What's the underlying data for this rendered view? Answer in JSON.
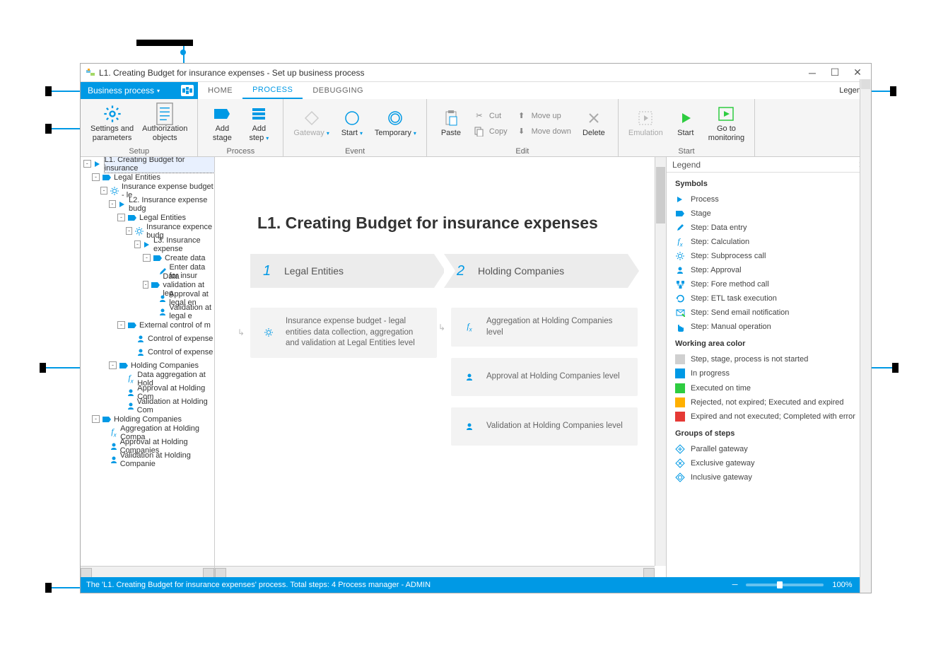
{
  "window": {
    "title": "L1. Creating Budget for insurance expenses - Set up business process"
  },
  "menubar": {
    "file_menu": "Business process",
    "tabs": [
      "HOME",
      "PROCESS",
      "DEBUGGING"
    ],
    "active_tab_index": 1,
    "right": "Legend"
  },
  "ribbon": {
    "groups": [
      {
        "label": "Setup",
        "buttons": [
          {
            "label": "Settings and\nparameters",
            "icon": "gear"
          },
          {
            "label": "Authorization\nobjects",
            "icon": "doc-lines"
          }
        ]
      },
      {
        "label": "Process",
        "buttons": [
          {
            "label": "Add\nstage",
            "icon": "stage-shape"
          },
          {
            "label": "Add\nstep",
            "icon": "bars",
            "dropdown": true
          }
        ]
      },
      {
        "label": "Event",
        "buttons": [
          {
            "label": "Gateway",
            "icon": "diamond",
            "disabled": true,
            "dropdown": true
          },
          {
            "label": "Start",
            "icon": "circle",
            "dropdown": true
          },
          {
            "label": "Temporary",
            "icon": "double-circle",
            "dropdown": true
          }
        ]
      },
      {
        "label": "Edit",
        "buttons_col1": [
          {
            "label": "Paste",
            "icon": "paste"
          }
        ],
        "small_buttons_col2": [
          {
            "label": "Cut",
            "icon": "scissors"
          },
          {
            "label": "Copy",
            "icon": "copy"
          }
        ],
        "small_buttons_col3": [
          {
            "label": "Move up",
            "icon": "arrow-up"
          },
          {
            "label": "Move down",
            "icon": "arrow-down"
          }
        ],
        "buttons_col4": [
          {
            "label": "Delete",
            "icon": "x"
          }
        ]
      },
      {
        "label": "Start",
        "buttons": [
          {
            "label": "Emulation",
            "icon": "play-dashed",
            "disabled": true
          },
          {
            "label": "Start",
            "icon": "play-green"
          },
          {
            "label": "Go to\nmonitoring",
            "icon": "play-box"
          }
        ]
      }
    ]
  },
  "tree": [
    {
      "lvl": 0,
      "exp": "-",
      "ico": "process",
      "label": "L1. Creating Budget for insurance",
      "sel": true
    },
    {
      "lvl": 1,
      "exp": "-",
      "ico": "stage",
      "label": "Legal Entities"
    },
    {
      "lvl": 2,
      "exp": "-",
      "ico": "subprocess",
      "label": "Insurance expense budget - le"
    },
    {
      "lvl": 3,
      "exp": "-",
      "ico": "process",
      "label": "L2. Insurance expense budg"
    },
    {
      "lvl": 4,
      "exp": "-",
      "ico": "stage",
      "label": "Legal Entities"
    },
    {
      "lvl": 5,
      "exp": "-",
      "ico": "subprocess",
      "label": "Insurance expence budg"
    },
    {
      "lvl": 6,
      "exp": "-",
      "ico": "process",
      "label": "L3. Insurance expense"
    },
    {
      "lvl": 6,
      "exp": "-",
      "ico": "stage",
      "label": "Create data",
      "lvlAdjust": 7
    },
    {
      "lvl": 6,
      "exp": "",
      "ico": "pencil",
      "label": "Enter data for insur",
      "lvlAdjust": 8
    },
    {
      "lvl": 6,
      "exp": "-",
      "ico": "stage",
      "label": "Data validation at leg",
      "lvlAdjust": 7
    },
    {
      "lvl": 6,
      "exp": "",
      "ico": "approval",
      "label": "Approval at legal en",
      "lvlAdjust": 8
    },
    {
      "lvl": 6,
      "exp": "",
      "ico": "approval",
      "label": "Validation at legal e",
      "lvlAdjust": 8
    },
    {
      "lvl": 4,
      "exp": "-",
      "ico": "stage",
      "label": "External control of m"
    },
    {
      "lvl": 5,
      "exp": "",
      "ico": "approval",
      "label": "Control of expense"
    },
    {
      "lvl": 5,
      "exp": "",
      "ico": "approval",
      "label": "Control of expense"
    },
    {
      "lvl": 3,
      "exp": "-",
      "ico": "stage",
      "label": "Holding Companies"
    },
    {
      "lvl": 4,
      "exp": "",
      "ico": "fx",
      "label": "Data aggregation at Hold"
    },
    {
      "lvl": 4,
      "exp": "",
      "ico": "approval",
      "label": "Approval at Holding Com"
    },
    {
      "lvl": 4,
      "exp": "",
      "ico": "approval",
      "label": "Validation at Holding Com"
    },
    {
      "lvl": 1,
      "exp": "-",
      "ico": "stage",
      "label": "Holding Companies"
    },
    {
      "lvl": 2,
      "exp": "",
      "ico": "fx",
      "label": "Aggregation at Holding Compa"
    },
    {
      "lvl": 2,
      "exp": "",
      "ico": "approval",
      "label": "Approval at Holding Companies"
    },
    {
      "lvl": 2,
      "exp": "",
      "ico": "approval",
      "label": "Validation at Holding Companie"
    }
  ],
  "canvas": {
    "title": "L1. Creating Budget for insurance expenses",
    "stages": [
      {
        "num": "1",
        "name": "Legal Entities"
      },
      {
        "num": "2",
        "name": "Holding Companies"
      }
    ],
    "col1": [
      {
        "ico": "subprocess",
        "text": "Insurance expense budget - legal entities data collection, aggregation and validation at Legal Entities level"
      }
    ],
    "col2": [
      {
        "ico": "fx",
        "text": "Aggregation at Holding Companies level"
      },
      {
        "ico": "approval",
        "text": "Approval at Holding Companies level"
      },
      {
        "ico": "approval",
        "text": "Validation at Holding Companies level"
      }
    ]
  },
  "legend": {
    "header": "Legend",
    "sections": {
      "symbols": "Symbols",
      "symbols_items": [
        {
          "ico": "process",
          "label": "Process"
        },
        {
          "ico": "stage",
          "label": "Stage"
        },
        {
          "ico": "pencil",
          "label": "Step: Data entry"
        },
        {
          "ico": "fx",
          "label": "Step: Calculation"
        },
        {
          "ico": "subprocess",
          "label": "Step: Subprocess call"
        },
        {
          "ico": "approval",
          "label": "Step: Approval"
        },
        {
          "ico": "fore",
          "label": "Step: Fore method call"
        },
        {
          "ico": "etl",
          "label": "Step: ETL task execution"
        },
        {
          "ico": "mail",
          "label": "Step: Send email notification"
        },
        {
          "ico": "manual",
          "label": "Step: Manual operation"
        }
      ],
      "colors": "Working area color",
      "colors_items": [
        {
          "color": "#d0d0d0",
          "label": "Step, stage, process is not started"
        },
        {
          "color": "#0099e5",
          "label": "In progress"
        },
        {
          "color": "#2ecc40",
          "label": "Executed on time"
        },
        {
          "color": "#ffb000",
          "label": "Rejected, not expired; Executed and expired"
        },
        {
          "color": "#e53935",
          "label": "Expired and not executed; Completed with error"
        }
      ],
      "groups": "Groups of steps",
      "groups_items": [
        {
          "ico": "diamond-plus",
          "label": "Parallel gateway"
        },
        {
          "ico": "diamond-x",
          "label": "Exclusive gateway"
        },
        {
          "ico": "diamond-o",
          "label": "Inclusive gateway"
        }
      ]
    }
  },
  "statusbar": {
    "msg": "The 'L1. Creating Budget for insurance expenses' process. Total steps: 4 Process manager - ADMIN",
    "zoom": "100%"
  }
}
